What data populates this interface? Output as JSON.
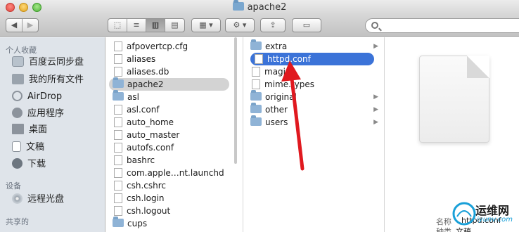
{
  "window": {
    "title": "apache2"
  },
  "toolbar": {
    "back": "◀",
    "forward": "▶",
    "view_icon": "⬚",
    "view_list": "≡",
    "view_columns": "▥",
    "view_coverflow": "▤",
    "arrange": "▦ ▾",
    "action": "⚙ ▾",
    "share": "⇪",
    "toggle": "▭"
  },
  "sidebar": {
    "favorites_header": "个人收藏",
    "favorites": [
      {
        "label": "百度云同步盘",
        "icon": "folder-icon"
      },
      {
        "label": "我的所有文件",
        "icon": "all-files-icon"
      },
      {
        "label": "AirDrop",
        "icon": "airdrop-icon"
      },
      {
        "label": "应用程序",
        "icon": "applications-icon"
      },
      {
        "label": "桌面",
        "icon": "desktop-icon"
      },
      {
        "label": "文稿",
        "icon": "documents-icon"
      },
      {
        "label": "下载",
        "icon": "download-icon"
      }
    ],
    "devices_header": "设备",
    "devices": [
      {
        "label": "远程光盘",
        "icon": "remote-disc-icon"
      }
    ],
    "shared_header": "共享的"
  },
  "column1": {
    "items": [
      {
        "label": "afpovertcp.cfg",
        "type": "file"
      },
      {
        "label": "aliases",
        "type": "alias"
      },
      {
        "label": "aliases.db",
        "type": "file"
      },
      {
        "label": "apache2",
        "type": "folder",
        "selected": true
      },
      {
        "label": "asl",
        "type": "folder"
      },
      {
        "label": "asl.conf",
        "type": "file"
      },
      {
        "label": "auto_home",
        "type": "file"
      },
      {
        "label": "auto_master",
        "type": "file"
      },
      {
        "label": "autofs.conf",
        "type": "file"
      },
      {
        "label": "bashrc",
        "type": "file"
      },
      {
        "label": "com.apple…nt.launchd",
        "type": "file"
      },
      {
        "label": "csh.cshrc",
        "type": "file"
      },
      {
        "label": "csh.login",
        "type": "file"
      },
      {
        "label": "csh.logout",
        "type": "file"
      },
      {
        "label": "cups",
        "type": "folder"
      }
    ]
  },
  "column2": {
    "items": [
      {
        "label": "extra",
        "type": "folder"
      },
      {
        "label": "httpd.conf",
        "type": "file",
        "selected": true
      },
      {
        "label": "magic",
        "type": "file"
      },
      {
        "label": "mime.types",
        "type": "file"
      },
      {
        "label": "original",
        "type": "folder"
      },
      {
        "label": "other",
        "type": "folder"
      },
      {
        "label": "users",
        "type": "folder"
      }
    ]
  },
  "preview": {
    "name_label": "名称",
    "name_value": "httpd.conf",
    "kind_label": "种类",
    "kind_value": "文稿"
  },
  "watermark": {
    "text": "运维网",
    "subtext": "iyunv.com"
  },
  "colors": {
    "selection": "#3b73d8",
    "annotation_arrow": "#e0191f"
  }
}
